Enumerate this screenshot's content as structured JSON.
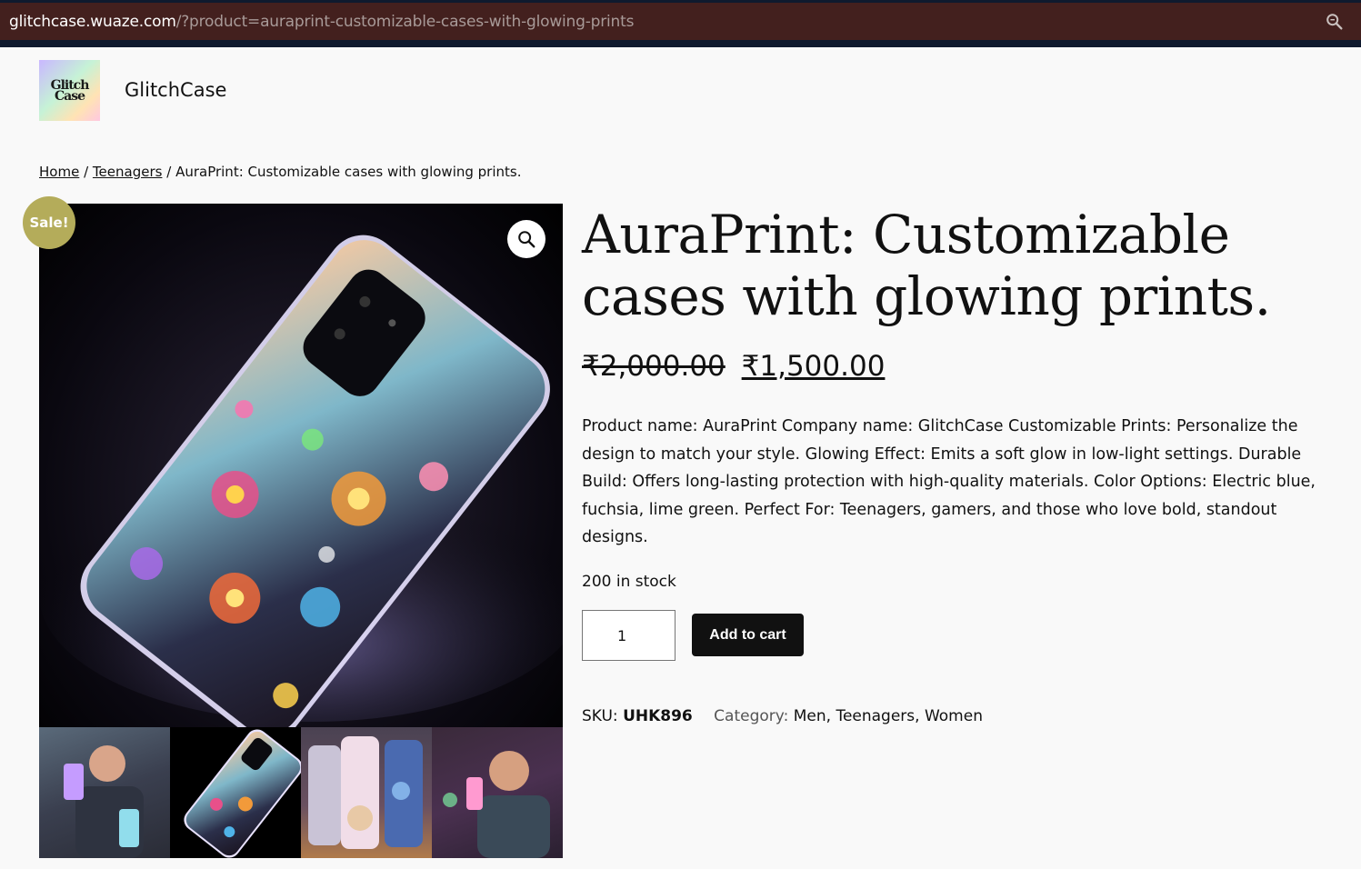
{
  "browser": {
    "url_host": "glitchcase.wuaze.com",
    "url_path": "/?product=auraprint-customizable-cases-with-glowing-prints",
    "search_icon": "search-icon"
  },
  "header": {
    "logo_text_line1": "Glitch",
    "logo_text_line2": "Case",
    "site_title": "GlitchCase"
  },
  "breadcrumb": {
    "home": "Home",
    "separator": "/",
    "category": "Teenagers",
    "current": "AuraPrint: Customizable cases with glowing prints."
  },
  "gallery": {
    "sale_badge": "Sale!",
    "zoom_icon": "🔍",
    "thumbnails": [
      "teen-holding-glowing-cases",
      "floral-glowing-case",
      "kitten-and-galaxy-cases",
      "smiling-teen-with-case"
    ]
  },
  "product": {
    "title": "AuraPrint: Customizable cases with glowing prints.",
    "price_regular": "₹2,000.00",
    "price_sale": "₹1,500.00",
    "description": "Product name: AuraPrint Company name: GlitchCase Customizable Prints: Personalize the design to match your style. Glowing Effect: Emits a soft glow in low-light settings. Durable Build: Offers long-lasting protection with high-quality materials. Color Options: Electric blue, fuchsia, lime green. Perfect For: Teenagers, gamers, and those who love bold, standout designs.",
    "stock": "200 in stock",
    "quantity": "1",
    "add_to_cart": "Add to cart",
    "sku_label": "SKU:",
    "sku": "UHK896",
    "category_label": "Category:",
    "categories": [
      "Men",
      "Teenagers",
      "Women"
    ]
  },
  "colors": {
    "urlbar_bg": "#43201e",
    "sale_badge": "#b4ac5a",
    "button_bg": "#111111"
  }
}
